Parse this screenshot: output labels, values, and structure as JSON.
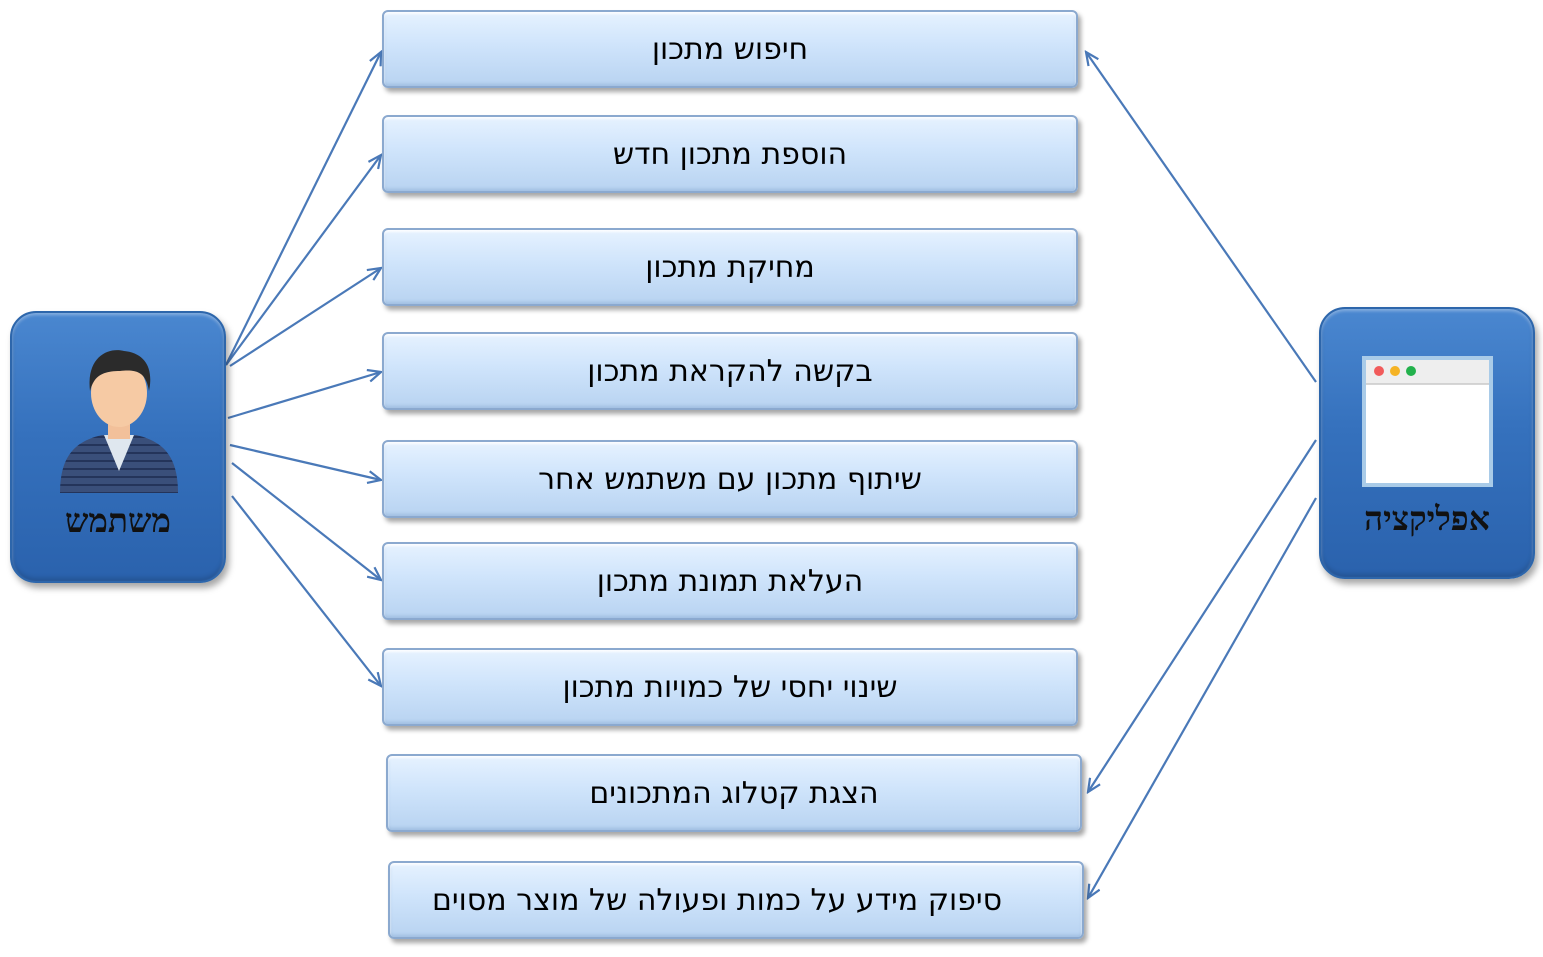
{
  "actors": {
    "user": {
      "label": "משתמש",
      "icon": "user-avatar-icon"
    },
    "app": {
      "label": "אפליקציה",
      "icon": "browser-window-icon"
    }
  },
  "use_cases": [
    {
      "label": "חיפוש מתכון",
      "actor": "user"
    },
    {
      "label": "הוספת מתכון חדש",
      "actor": "user"
    },
    {
      "label": "מחיקת מתכון",
      "actor": "user"
    },
    {
      "label": "בקשה להקראת מתכון",
      "actor": "user"
    },
    {
      "label": "שיתוף מתכון עם משתמש אחר",
      "actor": "user"
    },
    {
      "label": "העלאת תמונת מתכון",
      "actor": "user"
    },
    {
      "label": "שינוי יחסי של כמויות מתכון",
      "actor": "user"
    },
    {
      "label": "הצגת קטלוג המתכונים",
      "actor": "app"
    },
    {
      "label": "סיפוק מידע על כמות ופעולה של מוצר מסוים",
      "actor": "app"
    }
  ],
  "app_links": [
    0,
    7,
    8
  ],
  "colors": {
    "arrow": "#4a79b8",
    "actor_fill": "#3571bd",
    "case_fill": "#cfe4fb",
    "case_border": "#8ba9cf"
  }
}
